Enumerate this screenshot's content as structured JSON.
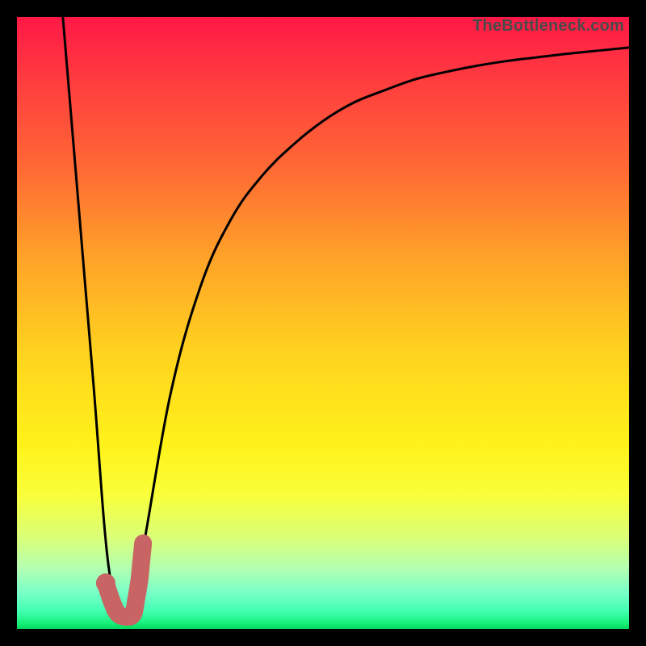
{
  "watermark": "TheBottleneck.com",
  "chart_data": {
    "type": "line",
    "title": "",
    "xlabel": "",
    "ylabel": "",
    "xlim": [
      0,
      100
    ],
    "ylim": [
      0,
      100
    ],
    "series": [
      {
        "name": "bottleneck-curve",
        "x": [
          7.5,
          10,
          12.5,
          15,
          17.5,
          20,
          25,
          30,
          35,
          40,
          45,
          50,
          55,
          60,
          65,
          70,
          75,
          80,
          85,
          90,
          95,
          100
        ],
        "values": [
          100,
          70,
          40,
          10,
          3,
          10,
          38,
          56,
          67,
          74,
          79,
          83,
          86,
          88,
          89.8,
          91,
          92,
          92.8,
          93.4,
          94,
          94.5,
          95
        ]
      }
    ],
    "highlight": {
      "name": "optimal-region",
      "color": "#c86464",
      "points_xy": [
        [
          14.5,
          7.5
        ],
        [
          15.5,
          4.5
        ],
        [
          16.5,
          2.5
        ],
        [
          18.0,
          2.0
        ],
        [
          19.0,
          2.5
        ],
        [
          19.5,
          5.0
        ],
        [
          20.0,
          8.0
        ],
        [
          20.3,
          11.0
        ],
        [
          20.6,
          14.0
        ]
      ],
      "dot_xy": [
        14.5,
        7.5
      ]
    }
  }
}
